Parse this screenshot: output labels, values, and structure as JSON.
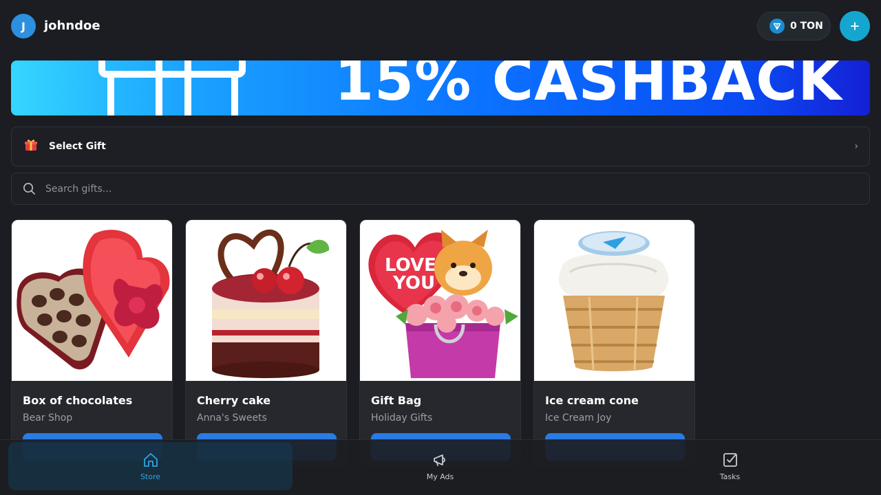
{
  "header": {
    "avatar_letter": "J",
    "username": "johndoe",
    "balance": "0 TON"
  },
  "banner": {
    "text": "15% CASHBACK"
  },
  "select_gift": {
    "label": "Select Gift",
    "icon": "gift-icon"
  },
  "search": {
    "placeholder": "Search gifts..."
  },
  "gifts": [
    {
      "title": "Box of chocolates",
      "shop": "Bear Shop",
      "icon": "heart-chocolate-box"
    },
    {
      "title": "Cherry cake",
      "shop": "Anna's Sweets",
      "icon": "cherry-cake"
    },
    {
      "title": "Gift Bag",
      "shop": "Holiday Gifts",
      "icon": "gift-bag-love"
    },
    {
      "title": "Ice cream cone",
      "shop": "Ice Cream Joy",
      "icon": "ice-cream-cone"
    }
  ],
  "nav": {
    "items": [
      {
        "label": "Store",
        "icon": "home-icon",
        "active": true
      },
      {
        "label": "My Ads",
        "icon": "megaphone-icon",
        "active": false
      },
      {
        "label": "Tasks",
        "icon": "checkbox-icon",
        "active": false
      }
    ]
  },
  "colors": {
    "background": "#1b1d22",
    "accent": "#15a6cf",
    "card_button": "#2a7be4",
    "active_nav": "#2ea6e6"
  }
}
